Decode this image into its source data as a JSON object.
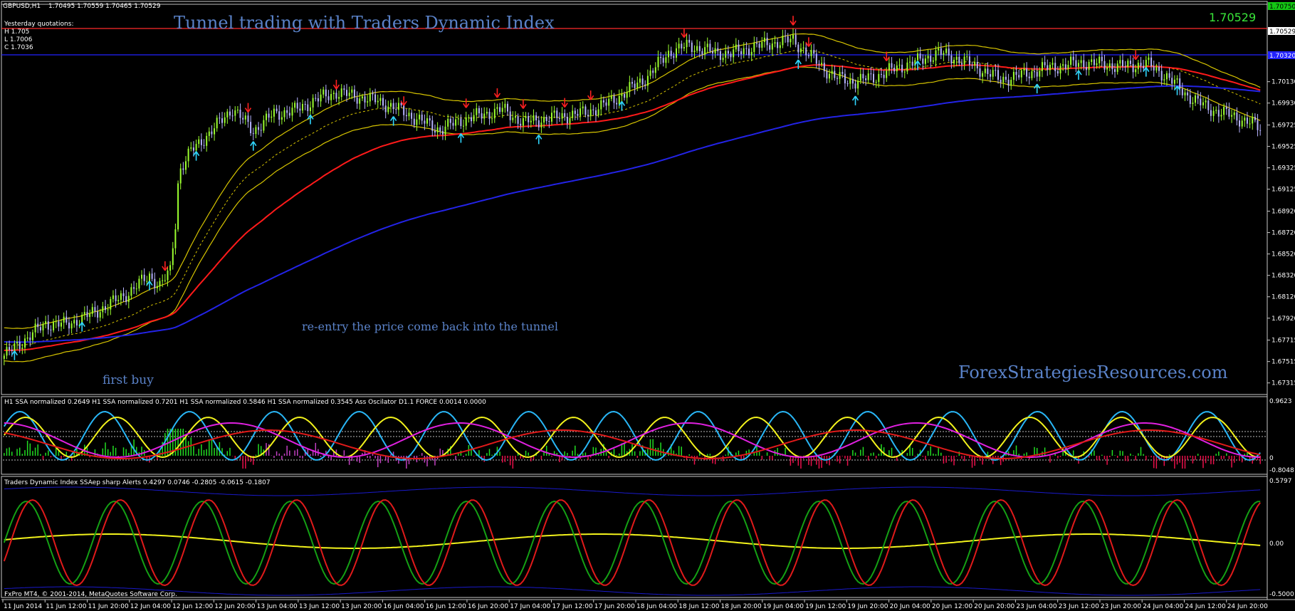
{
  "window": {
    "symbol_label": "GBPUSD,H1",
    "ohlc_label": "1.70495 1.70559 1.70465 1.70529",
    "yesterday": {
      "title": "Yesterday quotations:",
      "high": "H 1.705",
      "low": "L 1.7006",
      "close": "C 1.7036"
    },
    "big_price": "1.70529",
    "price_tag_top": "1.70750",
    "price_tag_current": "1.70529",
    "price_tag_blue": "1.70320"
  },
  "annotations": {
    "headline": "Tunnel trading  with Traders Dynamic Index",
    "reentry": "re-entry the price come back into the tunnel",
    "first_buy": "first buy",
    "watermark": "ForexStrategiesResources.com",
    "copyright": "FxPro MT4, © 2001-2014, MetaQuotes Software Corp."
  },
  "indicator1": {
    "legend": "H1 SSA normalized 0.2649  H1 SSA normalized 0.7201  H1 SSA normalized 0.5846  H1 SSA normalized 0.3545  Ass Oscilator D1.1  FORCE  0.0014 0.0000",
    "ticks": [
      "0.9623",
      "0",
      "-0.8048"
    ]
  },
  "indicator2": {
    "legend": "Traders Dynamic Index SSAep sharp Alerts  0.4297 0.0746 -0.2805 -0.0615 -0.1807",
    "ticks": [
      "0.5797",
      "0.00",
      "-0.5000"
    ]
  },
  "colors": {
    "background": "#000000",
    "bull_candle": "#9cff2f",
    "bear_candle": "#b6b3ff",
    "ema_red": "#ff1a1a",
    "ema_blue": "#2323e6",
    "envelope_yellow": "#d6c400",
    "cyan_arrow": "#2fd6ff",
    "red_arrow": "#ff2020",
    "annotation_text": "#5a82c8"
  },
  "chart_data": {
    "type": "candlestick",
    "symbol": "GBPUSD",
    "timeframe": "H1",
    "y_ticks": [
      "1.70130",
      "1.69930",
      "1.69725",
      "1.69525",
      "1.69325",
      "1.69125",
      "1.68920",
      "1.68720",
      "1.68520",
      "1.68320",
      "1.68120",
      "1.67920",
      "1.67715",
      "1.67515",
      "1.67315"
    ],
    "x_ticks": [
      "11 Jun 2014",
      "11 Jun 12:00",
      "11 Jun 20:00",
      "12 Jun 04:00",
      "12 Jun 12:00",
      "12 Jun 20:00",
      "13 Jun 04:00",
      "13 Jun 12:00",
      "13 Jun 20:00",
      "16 Jun 04:00",
      "16 Jun 12:00",
      "16 Jun 20:00",
      "17 Jun 04:00",
      "17 Jun 12:00",
      "17 Jun 20:00",
      "18 Jun 04:00",
      "18 Jun 12:00",
      "18 Jun 20:00",
      "19 Jun 04:00",
      "19 Jun 12:00",
      "19 Jun 20:00",
      "20 Jun 04:00",
      "20 Jun 12:00",
      "20 Jun 20:00",
      "23 Jun 04:00",
      "23 Jun 12:00",
      "23 Jun 20:00",
      "24 Jun 04:00",
      "24 Jun 12:00",
      "24 Jun 20:00"
    ],
    "price_range": [
      1.6722,
      1.708
    ],
    "close_anchors": [
      [
        0,
        1.6757
      ],
      [
        8,
        1.6772
      ],
      [
        16,
        1.6787
      ],
      [
        24,
        1.6786
      ],
      [
        32,
        1.6794
      ],
      [
        40,
        1.6804
      ],
      [
        48,
        1.6816
      ],
      [
        56,
        1.6832
      ],
      [
        60,
        1.6822
      ],
      [
        64,
        1.6836
      ],
      [
        68,
        1.6932
      ],
      [
        72,
        1.6948
      ],
      [
        80,
        1.6967
      ],
      [
        88,
        1.6988
      ],
      [
        96,
        1.6967
      ],
      [
        104,
        1.6983
      ],
      [
        112,
        1.6986
      ],
      [
        120,
        1.6996
      ],
      [
        128,
        1.7003
      ],
      [
        136,
        1.6999
      ],
      [
        144,
        1.6995
      ],
      [
        152,
        1.6987
      ],
      [
        160,
        1.6977
      ],
      [
        168,
        1.6968
      ],
      [
        176,
        1.6977
      ],
      [
        184,
        1.6982
      ],
      [
        192,
        1.6987
      ],
      [
        200,
        1.6975
      ],
      [
        208,
        1.6978
      ],
      [
        216,
        1.6981
      ],
      [
        224,
        1.6984
      ],
      [
        232,
        1.6992
      ],
      [
        240,
        1.7004
      ],
      [
        248,
        1.7018
      ],
      [
        256,
        1.704
      ],
      [
        264,
        1.7047
      ],
      [
        272,
        1.7041
      ],
      [
        280,
        1.7039
      ],
      [
        288,
        1.7045
      ],
      [
        296,
        1.7049
      ],
      [
        304,
        1.7052
      ],
      [
        312,
        1.7034
      ],
      [
        320,
        1.7017
      ],
      [
        328,
        1.7013
      ],
      [
        336,
        1.7018
      ],
      [
        344,
        1.7026
      ],
      [
        352,
        1.7032
      ],
      [
        360,
        1.704
      ],
      [
        368,
        1.7034
      ],
      [
        376,
        1.7025
      ],
      [
        384,
        1.7015
      ],
      [
        392,
        1.7019
      ],
      [
        400,
        1.7025
      ],
      [
        408,
        1.7028
      ],
      [
        416,
        1.7031
      ],
      [
        424,
        1.7029
      ],
      [
        432,
        1.7027
      ],
      [
        440,
        1.703
      ],
      [
        448,
        1.7018
      ],
      [
        456,
        1.7
      ],
      [
        464,
        1.6988
      ],
      [
        472,
        1.6982
      ],
      [
        480,
        1.6975
      ],
      [
        484,
        1.6969
      ]
    ],
    "buy_arrows_x": [
      4,
      30,
      56,
      74,
      96,
      118,
      150,
      176,
      206,
      238,
      306,
      328,
      352,
      398,
      414,
      440,
      452
    ],
    "sell_arrows_x": [
      62,
      94,
      128,
      154,
      178,
      190,
      200,
      216,
      226,
      262,
      304,
      310,
      340,
      436
    ]
  }
}
